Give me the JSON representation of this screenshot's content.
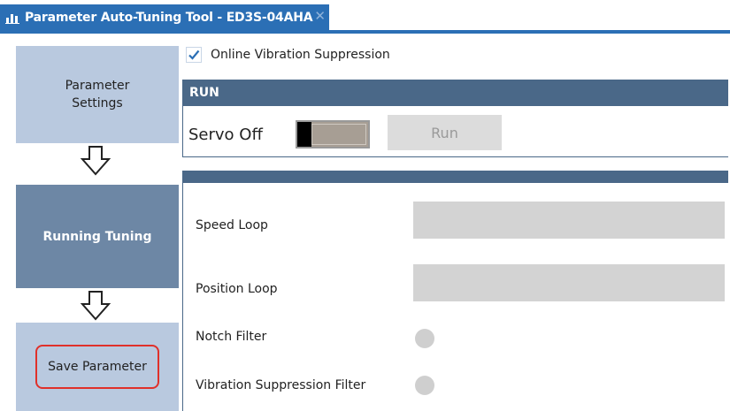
{
  "window": {
    "tab_title": "Parameter Auto-Tuning Tool - ED3S-04AHA",
    "tab_icon": "chart-icon",
    "close_icon": "close-icon",
    "accent_color": "#2b6fb5"
  },
  "steps": {
    "items": [
      {
        "label": "Parameter Settings",
        "state": "inactive",
        "color": "#b9c9df"
      },
      {
        "label": "Running Tuning",
        "state": "active",
        "color": "#6d87a5"
      },
      {
        "label": "Save Parameter",
        "state": "inactive",
        "color": "#b9c9df",
        "highlight_color": "#e0302a"
      }
    ],
    "arrow_icon": "down-arrow-icon"
  },
  "options": {
    "online_vibration_suppression": {
      "label": "Online Vibration Suppression",
      "checked": true
    }
  },
  "run": {
    "header": "RUN",
    "servo_label": "Servo Off",
    "servo_on": false,
    "run_button": "Run",
    "run_enabled": false
  },
  "tuning": {
    "speed_loop_label": "Speed Loop",
    "position_loop_label": "Position Loop",
    "notch_filter_label": "Notch Filter",
    "vibration_filter_label": "Vibration Suppression Filter",
    "notch_filter_active": false,
    "vibration_filter_active": false
  },
  "colors": {
    "panel_header": "#4a6888",
    "inactive_led": "#cfcfcf",
    "disabled_bar": "#d3d3d3"
  }
}
